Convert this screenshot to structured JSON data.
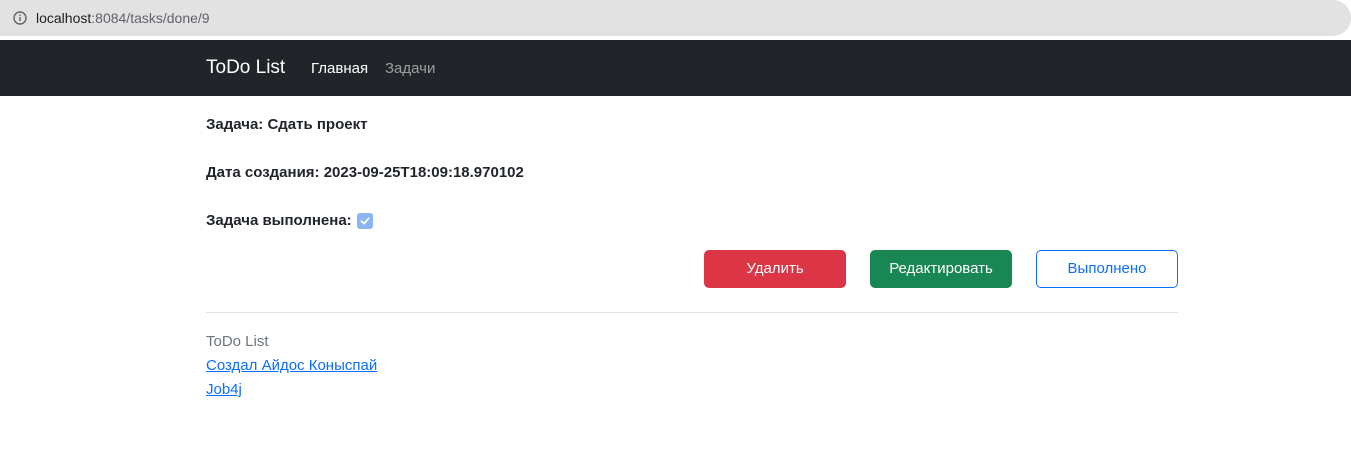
{
  "browser": {
    "url_host": "localhost",
    "url_rest": ":8084/tasks/done/9",
    "info_icon": "info-circle-icon"
  },
  "navbar": {
    "brand": "ToDo List",
    "links": [
      {
        "label": "Главная",
        "active": true
      },
      {
        "label": "Задачи",
        "active": false
      }
    ]
  },
  "task": {
    "title_text": "Задача: Сдать проект",
    "created_text": "Дата создания: 2023-09-25T18:09:18.970102",
    "done_label": "Задача выполнена:",
    "done_checked": true
  },
  "actions": {
    "delete_label": "Удалить",
    "edit_label": "Редактировать",
    "done_label": "Выполнено"
  },
  "footer": {
    "title": "ToDo List",
    "author_link": "Создал Айдос Коныспай",
    "project_link": "Job4j"
  },
  "colors": {
    "navbar_bg": "#212529",
    "danger": "#dc3545",
    "success": "#198754",
    "primary": "#0d6efd",
    "checkbox": "#8bb4f0"
  }
}
